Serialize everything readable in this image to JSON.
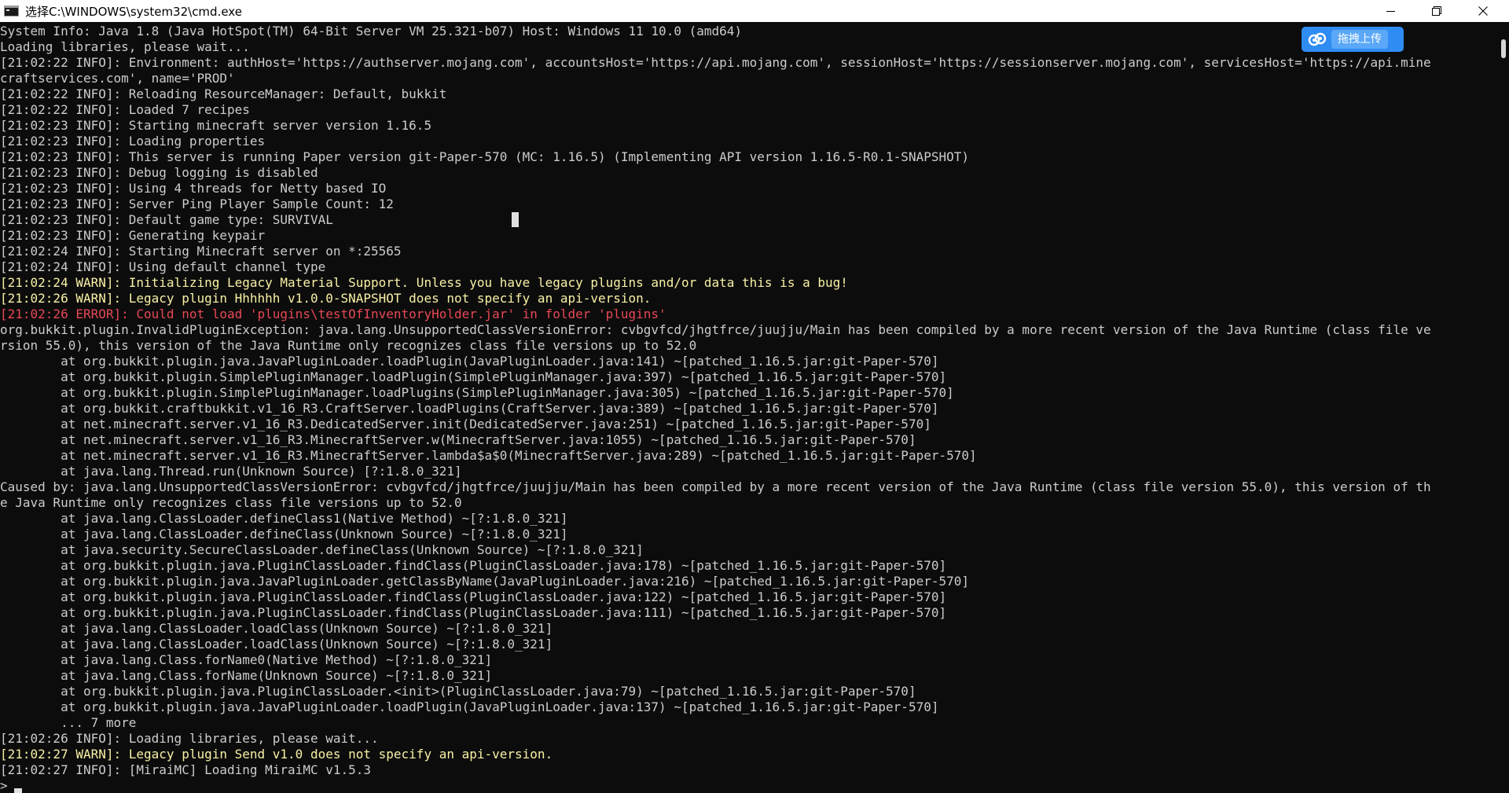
{
  "window": {
    "title": "选择C:\\WINDOWS\\system32\\cmd.exe"
  },
  "upload_badge": {
    "label": "拖拽上传"
  },
  "console": {
    "lines": [
      {
        "text": "System Info: Java 1.8 (Java HotSpot(TM) 64-Bit Server VM 25.321-b07) Host: Windows 11 10.0 (amd64)",
        "level": "plain"
      },
      {
        "text": "Loading libraries, please wait...",
        "level": "plain"
      },
      {
        "text": "[21:02:22 INFO]: Environment: authHost='https://authserver.mojang.com', accountsHost='https://api.mojang.com', sessionHost='https://sessionserver.mojang.com', servicesHost='https://api.mine",
        "level": "info"
      },
      {
        "text": "craftservices.com', name='PROD'",
        "level": "info"
      },
      {
        "text": "[21:02:22 INFO]: Reloading ResourceManager: Default, bukkit",
        "level": "info"
      },
      {
        "text": "[21:02:22 INFO]: Loaded 7 recipes",
        "level": "info"
      },
      {
        "text": "[21:02:23 INFO]: Starting minecraft server version 1.16.5",
        "level": "info"
      },
      {
        "text": "[21:02:23 INFO]: Loading properties",
        "level": "info"
      },
      {
        "text": "[21:02:23 INFO]: This server is running Paper version git-Paper-570 (MC: 1.16.5) (Implementing API version 1.16.5-R0.1-SNAPSHOT)",
        "level": "info"
      },
      {
        "text": "[21:02:23 INFO]: Debug logging is disabled",
        "level": "info"
      },
      {
        "text": "[21:02:23 INFO]: Using 4 threads for Netty based IO",
        "level": "info"
      },
      {
        "text": "[21:02:23 INFO]: Server Ping Player Sample Count: 12",
        "level": "info"
      },
      {
        "text": "[21:02:23 INFO]: Default game type: SURVIVAL",
        "level": "info"
      },
      {
        "text": "[21:02:23 INFO]: Generating keypair",
        "level": "info"
      },
      {
        "text": "[21:02:24 INFO]: Starting Minecraft server on *:25565",
        "level": "info"
      },
      {
        "text": "[21:02:24 INFO]: Using default channel type",
        "level": "info"
      },
      {
        "text": "[21:02:24 WARN]: Initializing Legacy Material Support. Unless you have legacy plugins and/or data this is a bug!",
        "level": "warn"
      },
      {
        "text": "[21:02:26 WARN]: Legacy plugin Hhhhhh v1.0.0-SNAPSHOT does not specify an api-version.",
        "level": "warn"
      },
      {
        "text": "[21:02:26 ERROR]: Could not load 'plugins\\testOfInventoryHolder.jar' in folder 'plugins'",
        "level": "error"
      },
      {
        "text": "org.bukkit.plugin.InvalidPluginException: java.lang.UnsupportedClassVersionError: cvbgvfcd/jhgtfrce/juujju/Main has been compiled by a more recent version of the Java Runtime (class file ve",
        "level": "plain"
      },
      {
        "text": "rsion 55.0), this version of the Java Runtime only recognizes class file versions up to 52.0",
        "level": "plain"
      },
      {
        "text": "        at org.bukkit.plugin.java.JavaPluginLoader.loadPlugin(JavaPluginLoader.java:141) ~[patched_1.16.5.jar:git-Paper-570]",
        "level": "plain"
      },
      {
        "text": "        at org.bukkit.plugin.SimplePluginManager.loadPlugin(SimplePluginManager.java:397) ~[patched_1.16.5.jar:git-Paper-570]",
        "level": "plain"
      },
      {
        "text": "        at org.bukkit.plugin.SimplePluginManager.loadPlugins(SimplePluginManager.java:305) ~[patched_1.16.5.jar:git-Paper-570]",
        "level": "plain"
      },
      {
        "text": "        at org.bukkit.craftbukkit.v1_16_R3.CraftServer.loadPlugins(CraftServer.java:389) ~[patched_1.16.5.jar:git-Paper-570]",
        "level": "plain"
      },
      {
        "text": "        at net.minecraft.server.v1_16_R3.DedicatedServer.init(DedicatedServer.java:251) ~[patched_1.16.5.jar:git-Paper-570]",
        "level": "plain"
      },
      {
        "text": "        at net.minecraft.server.v1_16_R3.MinecraftServer.w(MinecraftServer.java:1055) ~[patched_1.16.5.jar:git-Paper-570]",
        "level": "plain"
      },
      {
        "text": "        at net.minecraft.server.v1_16_R3.MinecraftServer.lambda$a$0(MinecraftServer.java:289) ~[patched_1.16.5.jar:git-Paper-570]",
        "level": "plain"
      },
      {
        "text": "        at java.lang.Thread.run(Unknown Source) [?:1.8.0_321]",
        "level": "plain"
      },
      {
        "text": "Caused by: java.lang.UnsupportedClassVersionError: cvbgvfcd/jhgtfrce/juujju/Main has been compiled by a more recent version of the Java Runtime (class file version 55.0), this version of th",
        "level": "plain"
      },
      {
        "text": "e Java Runtime only recognizes class file versions up to 52.0",
        "level": "plain"
      },
      {
        "text": "        at java.lang.ClassLoader.defineClass1(Native Method) ~[?:1.8.0_321]",
        "level": "plain"
      },
      {
        "text": "        at java.lang.ClassLoader.defineClass(Unknown Source) ~[?:1.8.0_321]",
        "level": "plain"
      },
      {
        "text": "        at java.security.SecureClassLoader.defineClass(Unknown Source) ~[?:1.8.0_321]",
        "level": "plain"
      },
      {
        "text": "        at org.bukkit.plugin.java.PluginClassLoader.findClass(PluginClassLoader.java:178) ~[patched_1.16.5.jar:git-Paper-570]",
        "level": "plain"
      },
      {
        "text": "        at org.bukkit.plugin.java.JavaPluginLoader.getClassByName(JavaPluginLoader.java:216) ~[patched_1.16.5.jar:git-Paper-570]",
        "level": "plain"
      },
      {
        "text": "        at org.bukkit.plugin.java.PluginClassLoader.findClass(PluginClassLoader.java:122) ~[patched_1.16.5.jar:git-Paper-570]",
        "level": "plain"
      },
      {
        "text": "        at org.bukkit.plugin.java.PluginClassLoader.findClass(PluginClassLoader.java:111) ~[patched_1.16.5.jar:git-Paper-570]",
        "level": "plain"
      },
      {
        "text": "        at java.lang.ClassLoader.loadClass(Unknown Source) ~[?:1.8.0_321]",
        "level": "plain"
      },
      {
        "text": "        at java.lang.ClassLoader.loadClass(Unknown Source) ~[?:1.8.0_321]",
        "level": "plain"
      },
      {
        "text": "        at java.lang.Class.forName0(Native Method) ~[?:1.8.0_321]",
        "level": "plain"
      },
      {
        "text": "        at java.lang.Class.forName(Unknown Source) ~[?:1.8.0_321]",
        "level": "plain"
      },
      {
        "text": "        at org.bukkit.plugin.java.PluginClassLoader.<init>(PluginClassLoader.java:79) ~[patched_1.16.5.jar:git-Paper-570]",
        "level": "plain"
      },
      {
        "text": "        at org.bukkit.plugin.java.JavaPluginLoader.loadPlugin(JavaPluginLoader.java:137) ~[patched_1.16.5.jar:git-Paper-570]",
        "level": "plain"
      },
      {
        "text": "        ... 7 more",
        "level": "plain"
      },
      {
        "text": "[21:02:26 INFO]: Loading libraries, please wait...",
        "level": "info"
      },
      {
        "text": "[21:02:27 WARN]: Legacy plugin Send v1.0 does not specify an api-version.",
        "level": "warn"
      },
      {
        "text": "[21:02:27 INFO]: [MiraiMC] Loading MiraiMC v1.5.3",
        "level": "info"
      }
    ],
    "prompt": ">"
  },
  "colors": {
    "background": "#0c0c0c",
    "text": "#cccccc",
    "warn": "#f9f1a5",
    "error": "#e74856",
    "badge": "#2f8cf3"
  }
}
